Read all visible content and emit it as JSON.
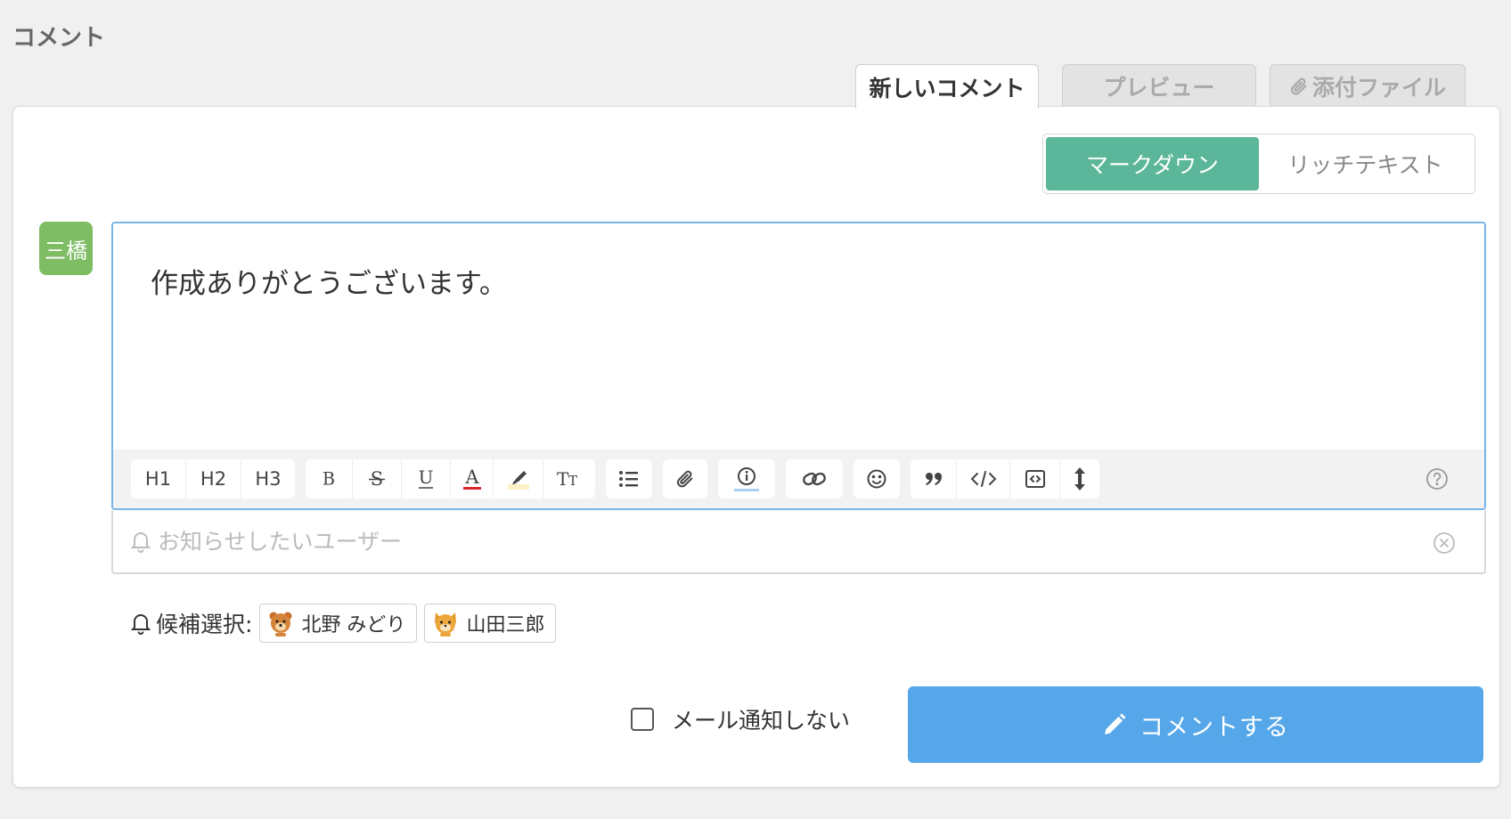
{
  "section_title": "コメント",
  "tabs": [
    {
      "label": "新しいコメント",
      "active": true
    },
    {
      "label": "プレビュー",
      "active": false
    },
    {
      "label": "添付ファイル",
      "active": false,
      "icon": "paperclip-icon"
    }
  ],
  "mode": {
    "options": [
      "マークダウン",
      "リッチテキスト"
    ],
    "selected": "マークダウン",
    "accent_color": "#5bb69a"
  },
  "author_avatar": {
    "label": "三橋",
    "color": "#7fbd64"
  },
  "editor": {
    "value": "作成ありがとうございます。"
  },
  "toolbar": {
    "headings": [
      "H1",
      "H2",
      "H3"
    ],
    "format_icons": [
      "bold-icon",
      "strikethrough-icon",
      "underline-icon",
      "text-color-icon",
      "highlight-icon",
      "font-size-icon"
    ],
    "other_icons": [
      "bullet-list-icon",
      "attach-icon",
      "info-icon",
      "link-icon",
      "emoji-icon",
      "quote-icon",
      "code-icon",
      "code-block-icon",
      "resize-icon",
      "help-icon"
    ]
  },
  "notify": {
    "placeholder": "お知らせしたいユーザー"
  },
  "candidates": {
    "label": "候補選択:",
    "users": [
      {
        "name": "北野 みどり",
        "icon": "bear-avatar-icon"
      },
      {
        "name": "山田三郎",
        "icon": "cat-avatar-icon"
      }
    ]
  },
  "mail_option": {
    "label": "メール通知しない",
    "checked": false
  },
  "submit": {
    "label": "コメントする",
    "color": "#55a7ea"
  }
}
